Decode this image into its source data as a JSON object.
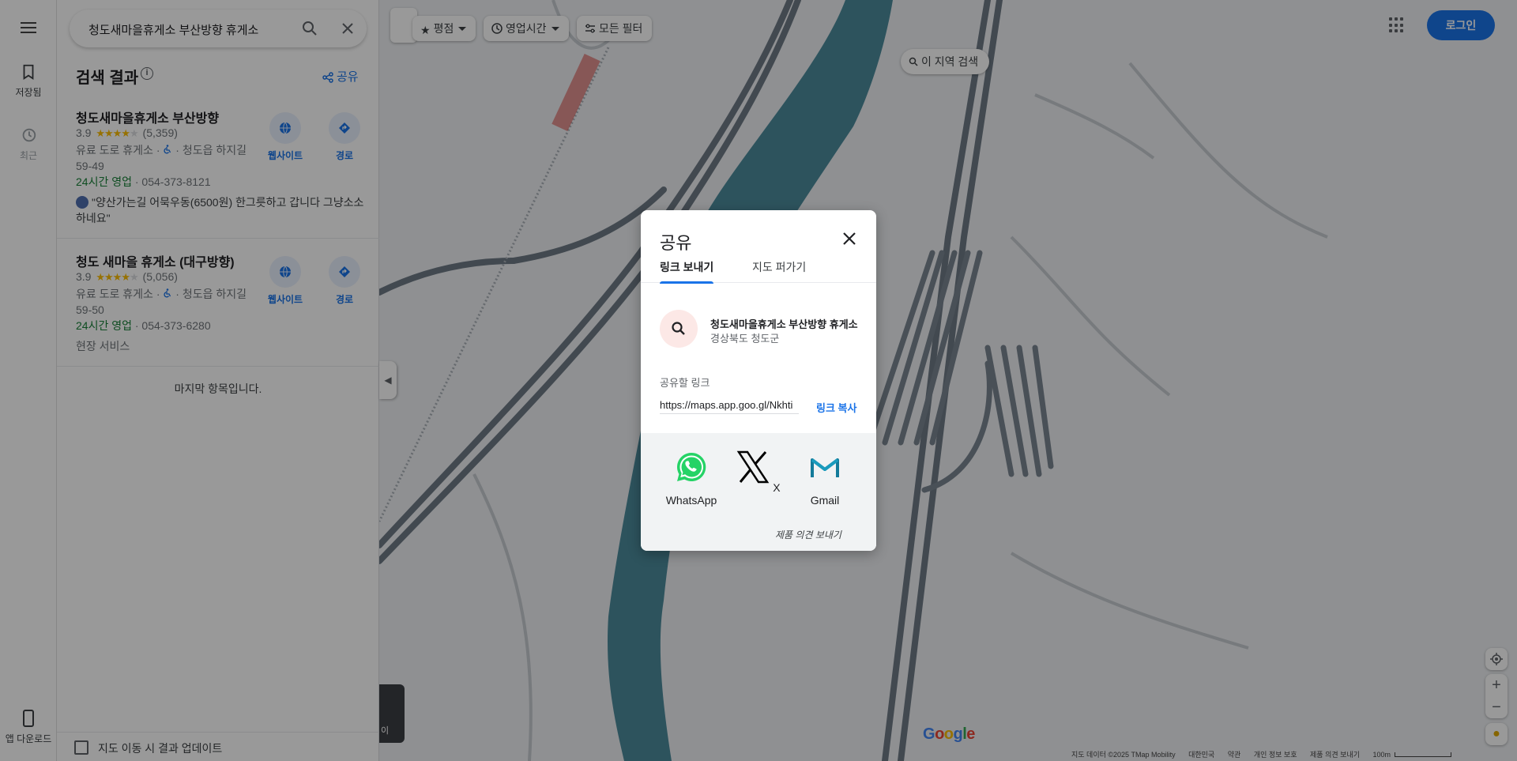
{
  "rail": {
    "saved_label": "저장됨",
    "recent_label": "최근",
    "app_download_label": "앱 다운로드"
  },
  "search": {
    "query": "청도새마을휴게소 부산방향 휴게소"
  },
  "results": {
    "title": "검색 결과",
    "share_label": "공유",
    "items": [
      {
        "name": "청도새마을휴게소 부산방향",
        "rating": "3.9",
        "review_count": "(5,359)",
        "category_line": "유료 도로 휴게소 · ",
        "address_line": " · 청도읍 하지길 59-49",
        "open_status": "24시간 영업",
        "phone": " · 054-373-8121",
        "review": "\"양산가는길 어묵우동(6500원) 한그릇하고 갑니다 그냥소소 하네요\"",
        "website_label": "웹사이트",
        "directions_label": "경로"
      },
      {
        "name": "청도 새마을 휴게소 (대구방향)",
        "rating": "3.9",
        "review_count": "(5,056)",
        "category_line": "유료 도로 휴게소 · ",
        "address_line": " · 청도읍 하지길 59-50",
        "open_status": "24시간 영업",
        "phone": " · 054-373-6280",
        "service": "현장 서비스",
        "website_label": "웹사이트",
        "directions_label": "경로"
      }
    ],
    "end_label": "마지막 항목입니다.",
    "update_checkbox_label": "지도 이동 시 결과 업데이트"
  },
  "map": {
    "filters": [
      {
        "label": "평점",
        "icon": "star-icon"
      },
      {
        "label": "영업시간",
        "icon": "clock-icon"
      },
      {
        "label": "모든 필터",
        "icon": "sliders-icon"
      }
    ],
    "area_search_label": "이 지역 검색",
    "login_label": "로그인",
    "google_logo": "Google",
    "thumb_label": "이",
    "attribution": [
      "지도 데이터 ©2025 TMap Mobility",
      "대한민국",
      "약관",
      "개인 정보 보호",
      "제품 의견 보내기"
    ],
    "scale_label": "100m",
    "colors": {
      "water": "#4b8a9c",
      "road": "#6e7a86",
      "land": "#eef0f3",
      "accent": "#1a73e8"
    }
  },
  "dialog": {
    "title": "공유",
    "tabs": [
      "링크 보내기",
      "지도 퍼가기"
    ],
    "active_tab": "링크 보내기",
    "place_name": "청도새마을휴게소 부산방향 휴게소",
    "place_address": "경상북도 청도군",
    "link_label": "공유할 링크",
    "link_value": "https://maps.app.goo.gl/Nkhti",
    "copy_label": "링크 복사",
    "services": [
      "WhatsApp",
      "X",
      "Gmail"
    ],
    "feedback_label": "제품 의견 보내기"
  }
}
